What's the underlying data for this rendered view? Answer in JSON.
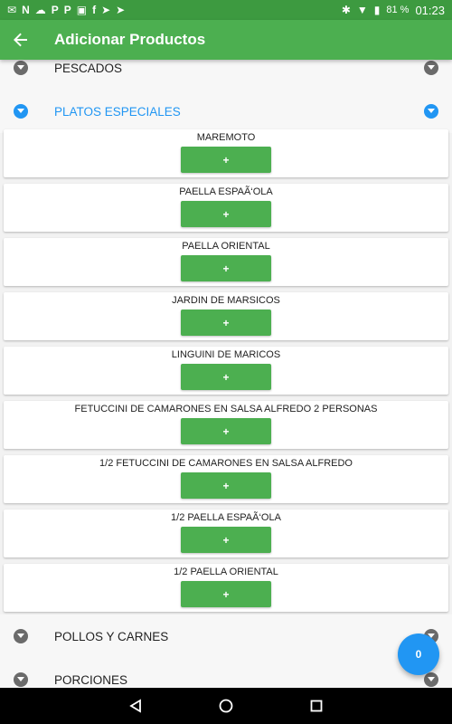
{
  "status_bar": {
    "left_icons": [
      "mail-icon",
      "n-icon",
      "cloud-icon",
      "p-icon",
      "p-icon",
      "flipboard-icon",
      "f-icon",
      "send-icon",
      "send-icon"
    ],
    "battery": "81 %",
    "time": "01:23"
  },
  "app_bar": {
    "title": "Adicionar Productos"
  },
  "sections_top": [
    {
      "label": "PESCADOS",
      "expanded": false
    },
    {
      "label": "PLATOS ESPECIALES",
      "expanded": true
    }
  ],
  "products": [
    {
      "name": "MAREMOTO",
      "button": "+"
    },
    {
      "name": "PAELLA ESPAÃ‘OLA",
      "button": "+"
    },
    {
      "name": "PAELLA ORIENTAL",
      "button": "+"
    },
    {
      "name": "JARDIN DE MARSICOS",
      "button": "+"
    },
    {
      "name": "LINGUINI DE MARICOS",
      "button": "+"
    },
    {
      "name": "FETUCCINI DE CAMARONES EN SALSA ALFREDO 2 PERSONAS",
      "button": "+"
    },
    {
      "name": "1/2 FETUCCINI DE CAMARONES EN SALSA ALFREDO",
      "button": "+"
    },
    {
      "name": "1/2 PAELLA ESPAÃ‘OLA",
      "button": "+"
    },
    {
      "name": "1/2 PAELLA ORIENTAL",
      "button": "+"
    }
  ],
  "sections_bottom": [
    {
      "label": "POLLOS Y CARNES",
      "expanded": false
    },
    {
      "label": "PORCIONES",
      "expanded": false
    }
  ],
  "fab": {
    "count": "0"
  },
  "colors": {
    "primary": "#4caf50",
    "primary_dark": "#3d9a40",
    "accent": "#2196f3"
  }
}
